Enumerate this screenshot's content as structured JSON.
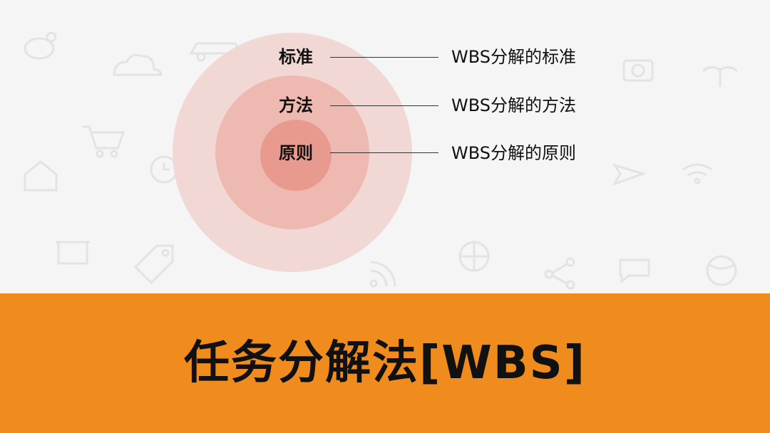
{
  "diagram": {
    "rings": [
      {
        "label": "标准",
        "description": "WBS分解的标准"
      },
      {
        "label": "方法",
        "description": "WBS分解的方法"
      },
      {
        "label": "原则",
        "description": "WBS分解的原则"
      }
    ]
  },
  "banner": {
    "title": "任务分解法[WBS]"
  },
  "colors": {
    "outer_ring": "#f1d8d4",
    "middle_ring": "#eeb9b0",
    "inner_ring": "#e99a8e",
    "banner": "#f08c1e"
  }
}
